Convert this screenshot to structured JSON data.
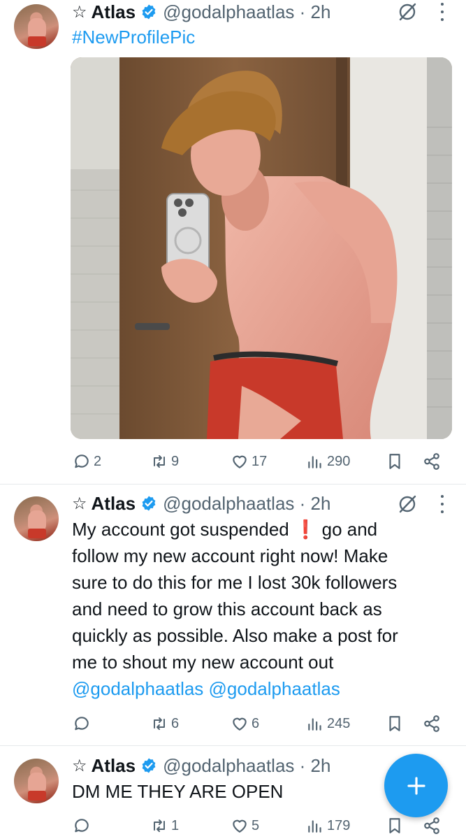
{
  "posts": [
    {
      "star": "☆",
      "name": "Atlas",
      "handle_time": "@godalphaatlas · 2h",
      "text_parts": [
        "#NewProfilePic"
      ],
      "has_media": true,
      "stats": {
        "replies": "2",
        "reposts": "9",
        "likes": "17",
        "views": "290"
      }
    },
    {
      "star": "☆",
      "name": "Atlas",
      "handle_time": "@godalphaatlas · 2h",
      "text_lines": [
        "My account got suspended",
        "follow my new account right now! Make",
        "sure to do this for me I lost 30k followers",
        "and need to grow this account back as",
        "quickly as possible. Also make a post for",
        "me to shout my new account out"
      ],
      "line1_suffix": "go and",
      "exclamation": "❗",
      "mentions": "@godalphaatlas @godalphaatlas",
      "stats": {
        "replies": "",
        "reposts": "6",
        "likes": "6",
        "views": "245"
      }
    },
    {
      "star": "☆",
      "name": "Atlas",
      "handle_time": "@godalphaatlas · 2h",
      "text": "DM ME THEY ARE OPEN",
      "stats": {
        "replies": "",
        "reposts": "1",
        "likes": "5",
        "views": "179"
      }
    }
  ],
  "colors": {
    "accent": "#1d9bf0",
    "muted": "#536471",
    "text": "#0f1419",
    "exclamation": "#e0245e"
  },
  "icons": [
    "grok-icon",
    "more-icon",
    "reply-icon",
    "repost-icon",
    "like-icon",
    "views-icon",
    "bookmark-icon",
    "share-icon",
    "verified-icon",
    "compose-icon"
  ]
}
